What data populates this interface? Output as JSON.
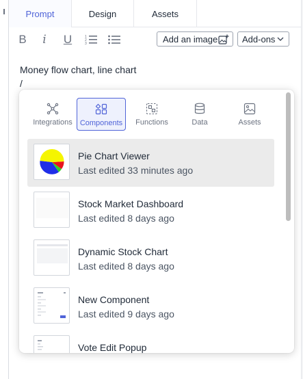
{
  "tabs": [
    {
      "label": "Prompt",
      "active": true
    },
    {
      "label": "Design",
      "active": false
    },
    {
      "label": "Assets",
      "active": false
    }
  ],
  "toolbar": {
    "bold_icon": "bold-icon",
    "italic_icon": "italic-icon",
    "underline_icon": "underline-icon",
    "ordered_list_icon": "ordered-list-icon",
    "bullet_list_icon": "bullet-list-icon",
    "add_image_label": "Add an image",
    "addons_label": "Add-ons"
  },
  "editor": {
    "prompt_text": "Money flow chart, line chart",
    "slash_text": "/"
  },
  "popup": {
    "categories": [
      {
        "label": "Integrations",
        "icon": "integrations-icon",
        "selected": false
      },
      {
        "label": "Components",
        "icon": "components-icon",
        "selected": true
      },
      {
        "label": "Functions",
        "icon": "functions-icon",
        "selected": false
      },
      {
        "label": "Data",
        "icon": "database-icon",
        "selected": false
      },
      {
        "label": "Assets",
        "icon": "image-icon",
        "selected": false
      }
    ],
    "items": [
      {
        "title": "Pie Chart Viewer",
        "subtitle": "Last edited 33 minutes ago",
        "selected": true
      },
      {
        "title": "Stock Market Dashboard",
        "subtitle": "Last edited 8 days ago",
        "selected": false
      },
      {
        "title": "Dynamic Stock Chart",
        "subtitle": "Last edited 8 days ago",
        "selected": false
      },
      {
        "title": "New Component",
        "subtitle": "Last edited 9 days ago",
        "selected": false
      },
      {
        "title": "Vote Edit Popup",
        "subtitle": "",
        "selected": false
      }
    ]
  },
  "colors": {
    "accent": "#4f63d8",
    "selected_row": "#ebebeb",
    "pie_blue": "#1f2ee8",
    "pie_red": "#e8141c",
    "pie_yellow": "#f5f500",
    "pie_green": "#2fd126"
  }
}
